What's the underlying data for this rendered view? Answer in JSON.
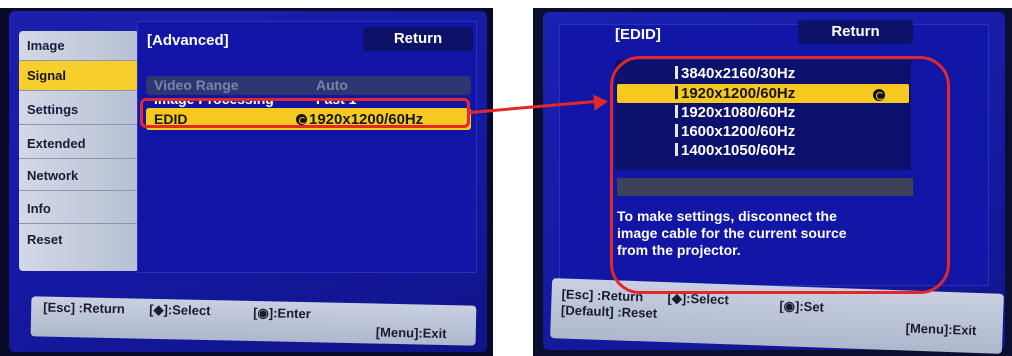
{
  "left_screen": {
    "tabs": [
      {
        "label": "Image",
        "active": false
      },
      {
        "label": "Signal",
        "active": true
      },
      {
        "label": "Settings",
        "active": false
      },
      {
        "label": "Extended",
        "active": false
      },
      {
        "label": "Network",
        "active": false
      },
      {
        "label": "Info",
        "active": false
      },
      {
        "label": "Reset",
        "active": false
      }
    ],
    "panel_title": "[Advanced]",
    "return_label": "Return",
    "rows": [
      {
        "label": "Video Range",
        "value": "Auto",
        "state": "disabled"
      },
      {
        "label": "Image Processing",
        "value": "Fast 1",
        "state": "partially-obscured"
      },
      {
        "label": "EDID",
        "value": "1920x1200/60Hz",
        "state": "selected",
        "value_icon": "set-circle-icon"
      }
    ],
    "help": {
      "return": "[Esc] :Return",
      "select": "[◆]:Select",
      "enter": "[◉]:Enter",
      "exit": "[Menu]:Exit"
    }
  },
  "right_screen": {
    "panel_title": "[EDID]",
    "return_label": "Return",
    "options": [
      {
        "label": "3840x2160/30Hz",
        "selected": false
      },
      {
        "label": "1920x1200/60Hz",
        "selected": true
      },
      {
        "label": "1920x1080/60Hz",
        "selected": false
      },
      {
        "label": "1600x1200/60Hz",
        "selected": false
      },
      {
        "label": "1400x1050/60Hz",
        "selected": false
      }
    ],
    "notice_lines": [
      "To make settings, disconnect the",
      "image cable for the current source",
      "from the projector."
    ],
    "help": {
      "return": "[Esc] :Return",
      "select": "[◆]:Select",
      "set": "[◉]:Set",
      "default": "[Default] :Reset",
      "exit": "[Menu]:Exit"
    }
  },
  "colors": {
    "menu_blue": "#15199c",
    "highlight_yellow": "#f5c91f",
    "annotation_red": "#e32828"
  }
}
